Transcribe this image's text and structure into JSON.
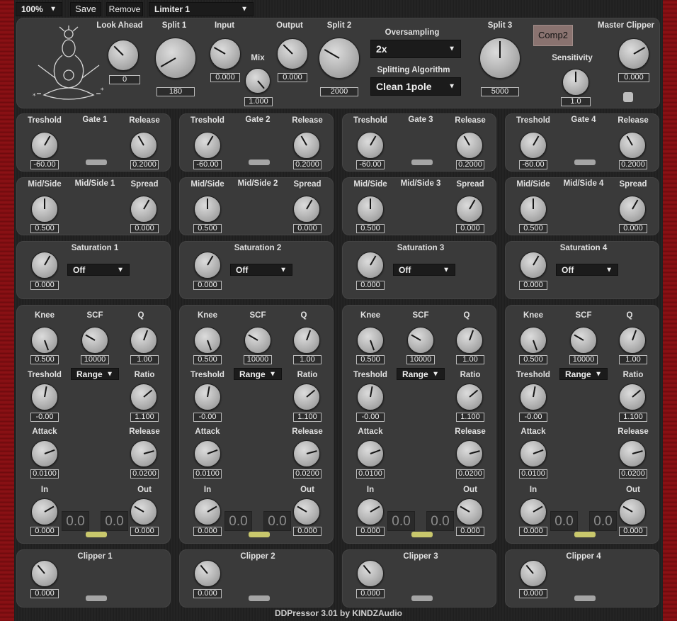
{
  "toolbar": {
    "zoom": "100%",
    "save": "Save",
    "remove": "Remove",
    "preset": "Limiter 1"
  },
  "top": {
    "look_ahead": {
      "label": "Look Ahead",
      "value": "0"
    },
    "split1": {
      "label": "Split 1",
      "value": "180"
    },
    "input": {
      "label": "Input",
      "value": "0.000"
    },
    "mix": {
      "label": "Mix",
      "value": "1.000"
    },
    "output": {
      "label": "Output",
      "value": "0.000"
    },
    "split2": {
      "label": "Split 2",
      "value": "2000"
    },
    "oversampling": {
      "label": "Oversampling",
      "value": "2x"
    },
    "splitting": {
      "label": "Splitting Algorithm",
      "value": "Clean 1pole"
    },
    "split3": {
      "label": "Split 3",
      "value": "5000"
    },
    "comp2": "Comp2",
    "sensitivity": {
      "label": "Sensitivity",
      "value": "1.0"
    },
    "master_clipper": {
      "label": "Master Clipper",
      "value": "0.000"
    }
  },
  "labels": {
    "treshold": "Treshold",
    "release": "Release",
    "midside": "Mid/Side",
    "spread": "Spread",
    "knee": "Knee",
    "scf": "SCF",
    "q": "Q",
    "ratio": "Ratio",
    "attack": "Attack",
    "in": "In",
    "out": "Out",
    "range": "Range"
  },
  "bands": [
    {
      "gate": "Gate 1",
      "ms": "Mid/Side 1",
      "sat": "Saturation 1",
      "clip": "Clipper 1",
      "sat_mode": "Off",
      "gate_th": "-60.00",
      "gate_rel": "0.2000",
      "ms_val": "0.500",
      "spread": "0.000",
      "sat_val": "0.000",
      "knee": "0.500",
      "scf": "10000",
      "q": "1.00",
      "thresh": "-0.00",
      "ratio": "1.100",
      "attack": "0.0100",
      "release": "0.0200",
      "in": "0.000",
      "out": "0.000",
      "meter_in": "0.0",
      "meter_out": "0.0",
      "clip_val": "0.000"
    },
    {
      "gate": "Gate 2",
      "ms": "Mid/Side 2",
      "sat": "Saturation 2",
      "clip": "Clipper 2",
      "sat_mode": "Off",
      "gate_th": "-60.00",
      "gate_rel": "0.2000",
      "ms_val": "0.500",
      "spread": "0.000",
      "sat_val": "0.000",
      "knee": "0.500",
      "scf": "10000",
      "q": "1.00",
      "thresh": "-0.00",
      "ratio": "1.100",
      "attack": "0.0100",
      "release": "0.0200",
      "in": "0.000",
      "out": "0.000",
      "meter_in": "0.0",
      "meter_out": "0.0",
      "clip_val": "0.000"
    },
    {
      "gate": "Gate 3",
      "ms": "Mid/Side 3",
      "sat": "Saturation 3",
      "clip": "Clipper 3",
      "sat_mode": "Off",
      "gate_th": "-60.00",
      "gate_rel": "0.2000",
      "ms_val": "0.500",
      "spread": "0.000",
      "sat_val": "0.000",
      "knee": "0.500",
      "scf": "10000",
      "q": "1.00",
      "thresh": "-0.00",
      "ratio": "1.100",
      "attack": "0.0100",
      "release": "0.0200",
      "in": "0.000",
      "out": "0.000",
      "meter_in": "0.0",
      "meter_out": "0.0",
      "clip_val": "0.000"
    },
    {
      "gate": "Gate 4",
      "ms": "Mid/Side 4",
      "sat": "Saturation 4",
      "clip": "Clipper 4",
      "sat_mode": "Off",
      "gate_th": "-60.00",
      "gate_rel": "0.2000",
      "ms_val": "0.500",
      "spread": "0.000",
      "sat_val": "0.000",
      "knee": "0.500",
      "scf": "10000",
      "q": "1.00",
      "thresh": "-0.00",
      "ratio": "1.100",
      "attack": "0.0100",
      "release": "0.0200",
      "in": "0.000",
      "out": "0.000",
      "meter_in": "0.0",
      "meter_out": "0.0",
      "clip_val": "0.000"
    }
  ],
  "footer": "DDPressor 3.01 by KINDZAudio",
  "colors": {
    "rail": "#7a0c10",
    "panel": "#3a3a3a",
    "led_on": "#c9c86c",
    "comp2": "#8a7370"
  }
}
